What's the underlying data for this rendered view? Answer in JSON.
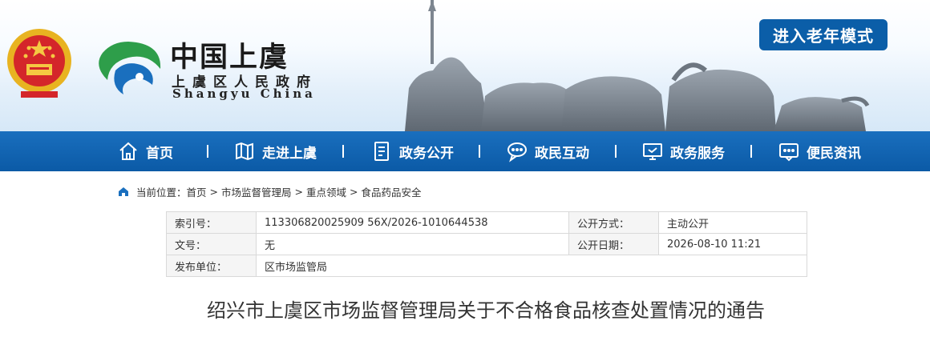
{
  "header": {
    "brand_cn": "中国上虞",
    "brand_sub": "上虞区人民政府",
    "brand_en": "Shangyu China",
    "elder_mode_label": "进入老年模式",
    "colors": {
      "primary": "#0b5ea8",
      "nav": "#1565b4"
    }
  },
  "nav": {
    "items": [
      {
        "label": "首页",
        "icon": "home-icon"
      },
      {
        "label": "走进上虞",
        "icon": "map-icon"
      },
      {
        "label": "政务公开",
        "icon": "document-icon"
      },
      {
        "label": "政民互动",
        "icon": "chat-icon"
      },
      {
        "label": "政务服务",
        "icon": "monitor-icon"
      },
      {
        "label": "便民资讯",
        "icon": "message-icon"
      }
    ]
  },
  "breadcrumb": {
    "prefix": "当前位置：",
    "items": [
      "首页",
      "市场监督管理局",
      "重点领域",
      "食品药品安全"
    ],
    "separator": ">"
  },
  "info": {
    "index_label": "索引号：",
    "index_value": "113306820025909 56X/2026-1010644538",
    "public_mode_label": "公开方式：",
    "public_mode_value": "主动公开",
    "doc_no_label": "文号：",
    "doc_no_value": "无",
    "public_date_label": "公开日期：",
    "public_date_value": "2026-08-10 11:21",
    "publisher_label": "发布单位：",
    "publisher_value": "区市场监管局"
  },
  "article": {
    "title": "绍兴市上虞区市场监督管理局关于不合格食品核查处置情况的通告"
  }
}
